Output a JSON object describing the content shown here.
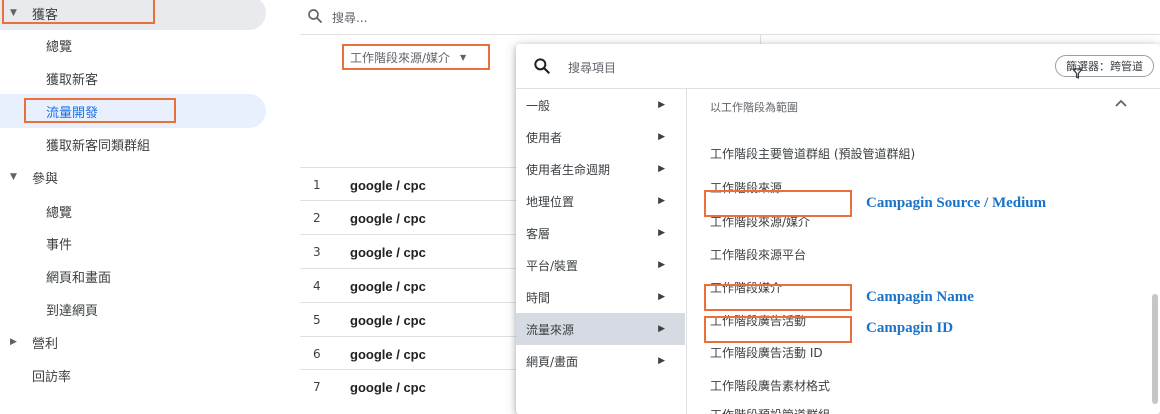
{
  "sidebar": {
    "acquisition": {
      "label": "獲客",
      "items": [
        "總覽",
        "獲取新客",
        "流量開發",
        "獲取新客同類群組"
      ]
    },
    "engagement": {
      "label": "參與",
      "items": [
        "總覽",
        "事件",
        "網頁和畫面",
        "到達網頁"
      ]
    },
    "monetization": {
      "label": "營利"
    },
    "retention": {
      "label": "回訪率"
    }
  },
  "main": {
    "search_placeholder": "搜尋...",
    "dimension_selector": "工作階段來源/媒介",
    "rows": [
      {
        "num": "1",
        "value": "google / cpc"
      },
      {
        "num": "2",
        "value": "google / cpc"
      },
      {
        "num": "3",
        "value": "google / cpc"
      },
      {
        "num": "4",
        "value": "google / cpc"
      },
      {
        "num": "5",
        "value": "google / cpc"
      },
      {
        "num": "6",
        "value": "google / cpc"
      },
      {
        "num": "7",
        "value": "google / cpc"
      }
    ]
  },
  "dropdown": {
    "search_placeholder": "搜尋項目",
    "filter_label": "篩選器：跨管道",
    "categories": [
      "一般",
      "使用者",
      "使用者生命週期",
      "地理位置",
      "客層",
      "平台/裝置",
      "時間",
      "流量來源",
      "網頁/畫面"
    ],
    "active_category": "流量來源",
    "section_title": "以工作階段為範圍",
    "options": [
      "工作階段主要管道群組 (預設管道群組)",
      "工作階段來源",
      "工作階段來源/媒介",
      "工作階段來源平台",
      "工作階段媒介",
      "工作階段廣告活動",
      "工作階段廣告活動 ID",
      "工作階段廣告素材格式",
      "工作階段預設管道群組"
    ]
  },
  "annotations": {
    "source_medium": "Campagin Source / Medium",
    "name": "Campagin Name",
    "id": "Campagin ID"
  },
  "colors": {
    "highlight": "#e8703a",
    "annotation": "#1a73c8",
    "active_sub": "#1a73e8"
  }
}
